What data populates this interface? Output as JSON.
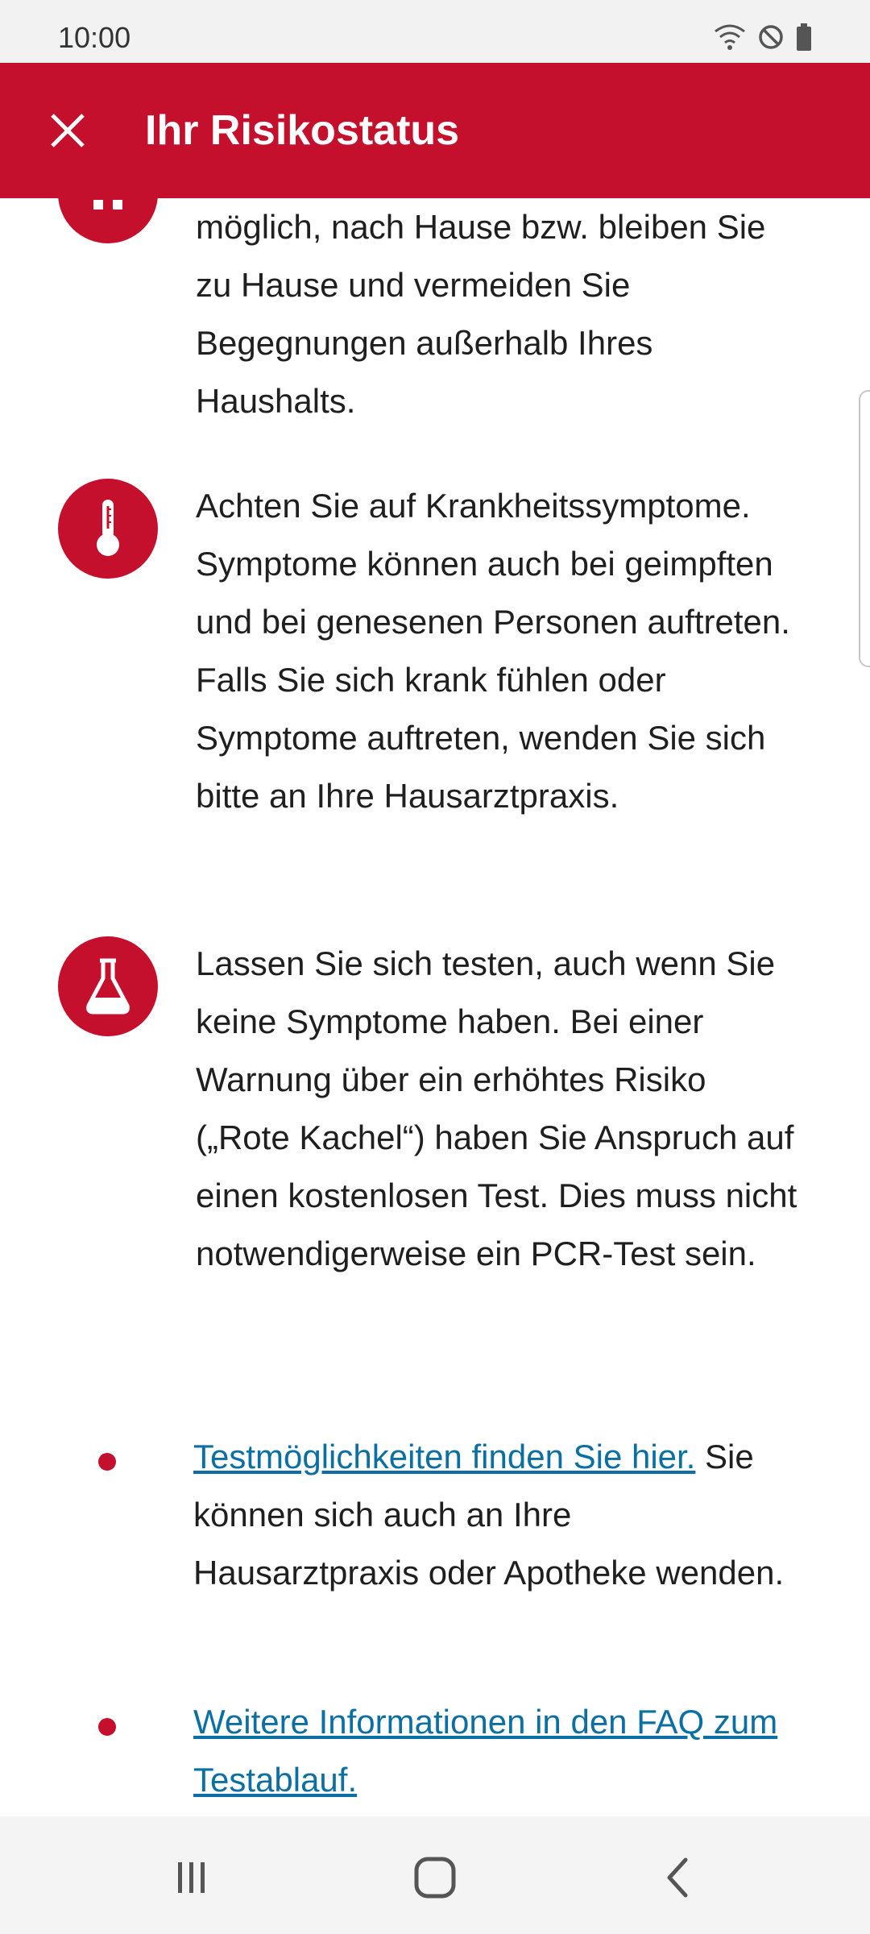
{
  "status_bar": {
    "time": "10:00",
    "icons": [
      "wifi-icon",
      "do-not-disturb-icon",
      "battery-icon"
    ]
  },
  "app_bar": {
    "title": "Ihr Risikostatus",
    "close_icon": "close-icon",
    "background_color": "#c4102d"
  },
  "sections": {
    "stay_home": {
      "text": "möglich, nach Hause bzw. bleiben Sie zu Hause und vermeiden Sie Begegnungen außerhalb Ihres Haushalts."
    },
    "symptoms": {
      "icon": "thermometer-icon",
      "text": "Achten Sie auf Krankheitssymptome. Symptome können auch bei geimpften und bei genesenen Personen auftreten. Falls Sie sich krank fühlen oder Symptome auftreten, wenden Sie sich bitte an Ihre Hausarztpraxis."
    },
    "testing": {
      "icon": "flask-icon",
      "text": "Lassen Sie sich testen, auch wenn Sie keine Symptome haben. Bei einer Warnung über ein erhöhtes Risiko („Rote Kachel“) haben Sie Anspruch auf einen kostenlosen Test. Dies muss nicht notwendigerweise ein PCR-Test sein."
    }
  },
  "bullets": {
    "test_options": {
      "link_text": "Testmöglichkeiten finden Sie hier.",
      "text": " Sie können sich auch an Ihre Hausarztpraxis oder Apotheke wenden."
    },
    "faq": {
      "link_text": "Weitere Informationen in den FAQ zum Testablauf."
    }
  },
  "nav_bar": {
    "icons": [
      "recent-apps-icon",
      "home-icon",
      "back-icon"
    ]
  }
}
